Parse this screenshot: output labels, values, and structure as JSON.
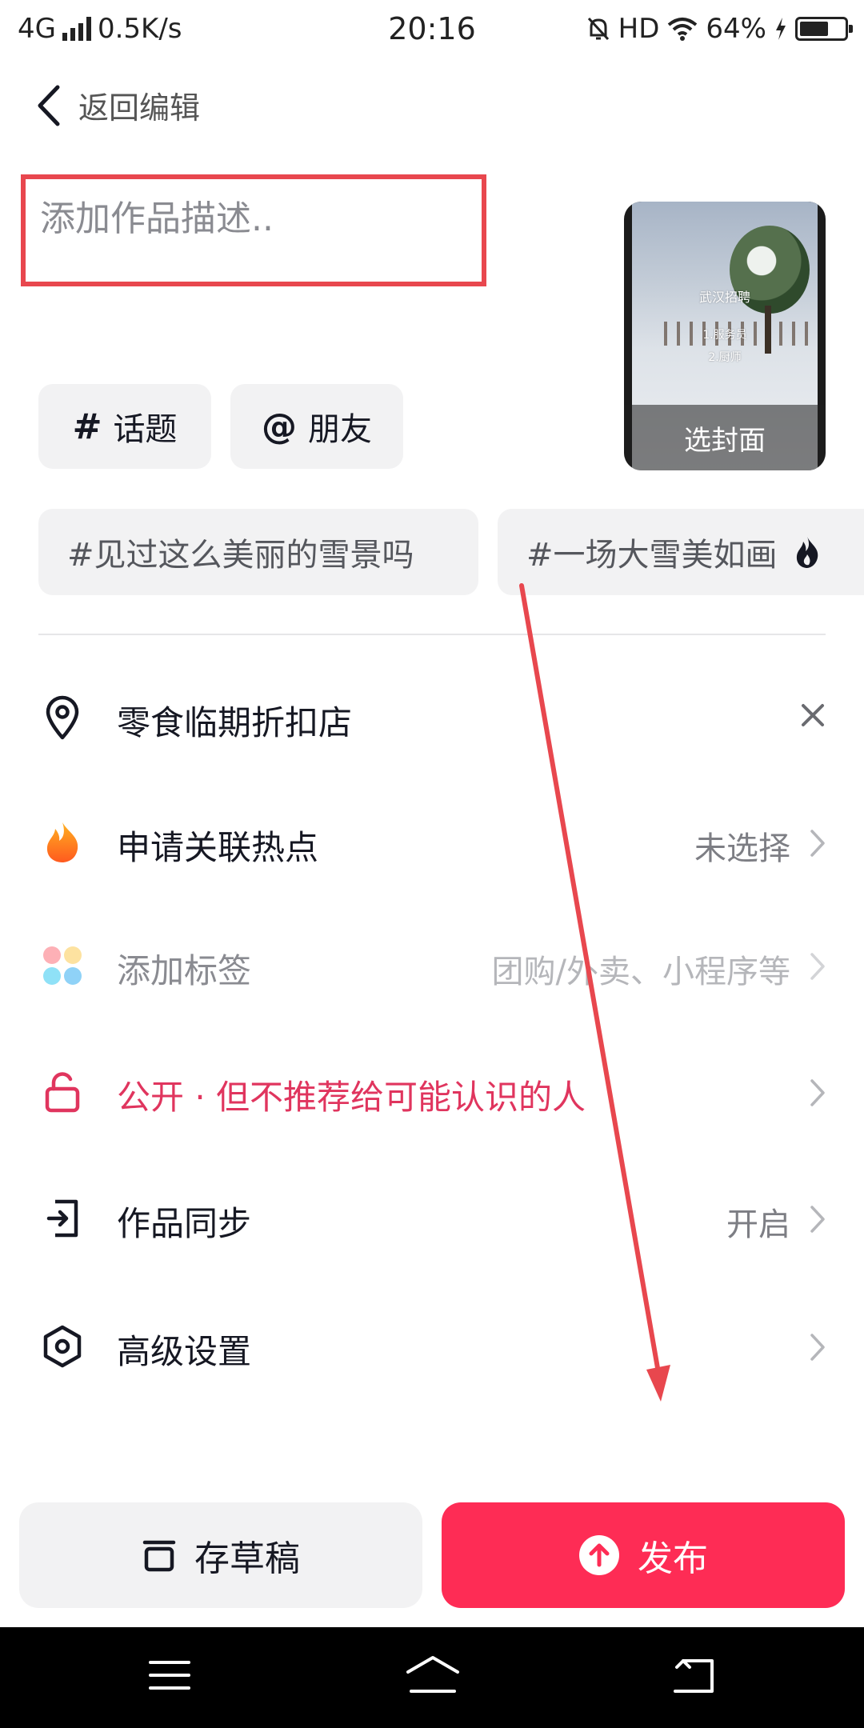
{
  "status_bar": {
    "network": "4G",
    "speed": "0.5K/s",
    "time": "20:16",
    "hd": "HD",
    "battery": "64%"
  },
  "header": {
    "back_label": "返回编辑"
  },
  "description": {
    "placeholder": "添加作品描述.."
  },
  "cover": {
    "overlay_title": "武汉招聘",
    "overlay_line1": "1.服务员",
    "overlay_line2": "2.厨师",
    "select_label": "选封面"
  },
  "chips": {
    "topic": {
      "symbol": "#",
      "label": "话题"
    },
    "friend": {
      "symbol": "@",
      "label": "朋友"
    }
  },
  "suggested_tags": [
    {
      "label": "#见过这么美丽的雪景吗"
    },
    {
      "label": "#一场大雪美如画"
    }
  ],
  "settings": [
    {
      "label": "零食临期折扣店",
      "value": "",
      "icon": "location-pin-icon"
    },
    {
      "label": "申请关联热点",
      "value": "未选择",
      "icon": "fire-icon"
    },
    {
      "label": "添加标签",
      "value": "团购/外卖、小程序等",
      "icon": "tag-dots-icon"
    },
    {
      "label": "公开 · 但不推荐给可能认识的人",
      "value": "",
      "icon": "unlock-icon"
    },
    {
      "label": "作品同步",
      "value": "开启",
      "icon": "sync-icon"
    },
    {
      "label": "高级设置",
      "value": "",
      "icon": "hexagon-settings-icon"
    }
  ],
  "buttons": {
    "draft": "存草稿",
    "publish": "发布"
  },
  "colors": {
    "accent": "#fe2c55",
    "privacy": "#e0355e",
    "annotation": "#e8474e"
  }
}
